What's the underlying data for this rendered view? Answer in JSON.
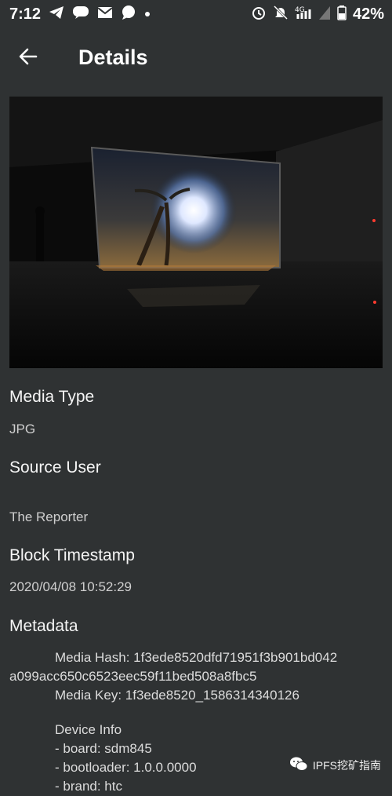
{
  "status_bar": {
    "time": "7:12",
    "battery": "42%",
    "icons_left": [
      "telegram-icon",
      "chat-icon",
      "gmail-icon",
      "message-icon",
      "dot-icon"
    ],
    "icons_right": [
      "alarm-icon",
      "mute-icon",
      "signal-4g-icon",
      "signal-icon",
      "battery-icon"
    ]
  },
  "app_bar": {
    "title": "Details",
    "back_icon": "arrow-left-icon"
  },
  "fields": {
    "media_type_label": "Media Type",
    "media_type_value": "JPG",
    "source_user_label": "Source User",
    "source_user_value": "The Reporter",
    "block_timestamp_label": "Block Timestamp",
    "block_timestamp_value": "2020/04/08 10:52:29",
    "metadata_label": "Metadata"
  },
  "metadata": {
    "media_hash_line1": "Media Hash: 1f3ede8520dfd71951f3b901bd042",
    "media_hash_line2": "a099acc650c6523eec59f11bed508a8fbc5",
    "media_key": "Media Key: 1f3ede8520_1586314340126",
    "device_info": "Device Info",
    "board": "- board: sdm845",
    "bootloader": "- bootloader: 1.0.0.0000",
    "brand": "- brand: htc"
  },
  "watermark": {
    "text": "IPFS挖矿指南"
  }
}
